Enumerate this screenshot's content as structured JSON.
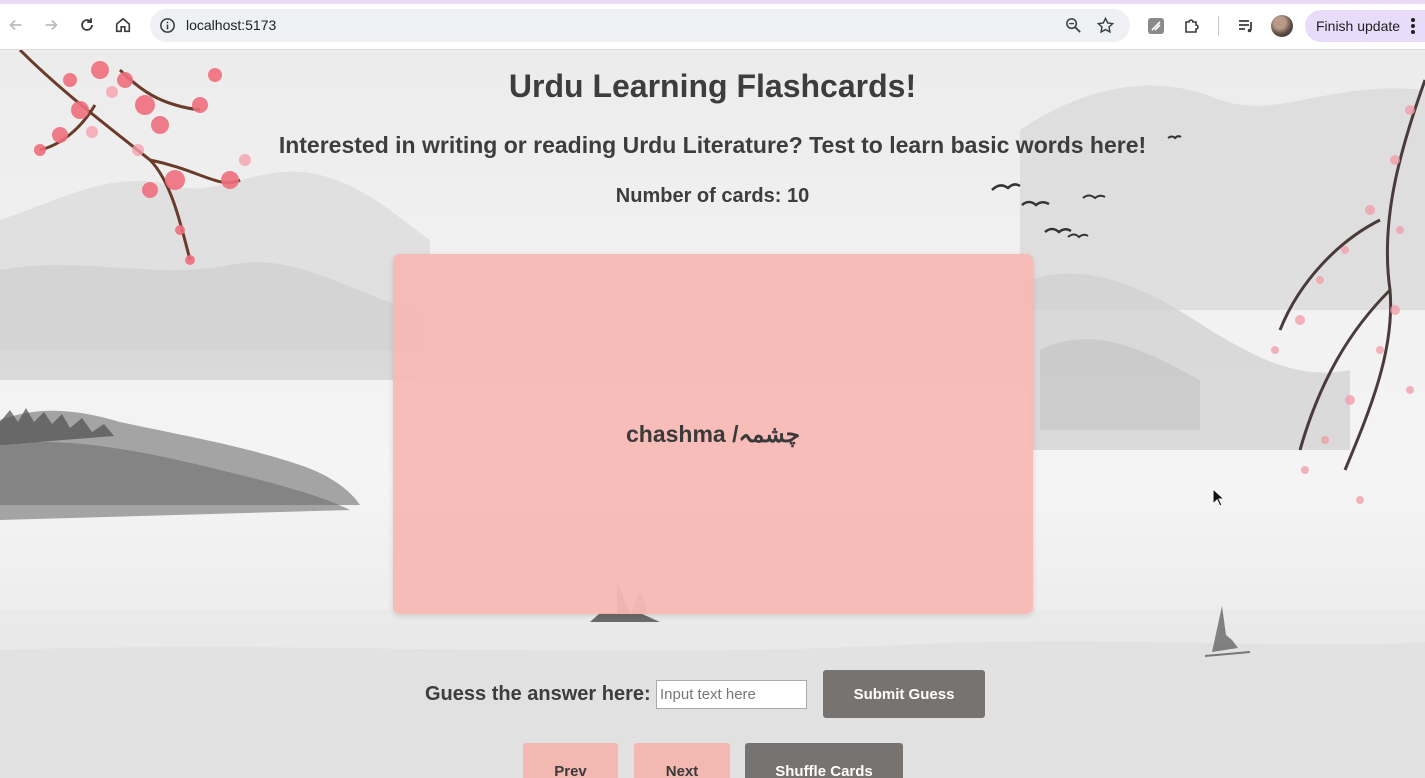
{
  "browser": {
    "url": "localhost:5173",
    "update_label": "Finish update"
  },
  "page": {
    "title": "Urdu Learning Flashcards!",
    "subtitle": "Interested in writing or reading Urdu Literature? Test to learn basic words here!",
    "card_count_label": "Number of cards:",
    "card_count": "10"
  },
  "card": {
    "text": "chashma /چشمہ"
  },
  "guess": {
    "label": "Guess the answer here:",
    "placeholder": "Input text here",
    "value": "",
    "submit_label": "Submit Guess"
  },
  "controls": {
    "prev_label": "Prev",
    "next_label": "Next",
    "shuffle_label": "Shuffle Cards"
  },
  "colors": {
    "card_pink": "#f8b7b4",
    "button_pink": "#f4b8b3",
    "button_gray": "#777370",
    "text_dark": "#3d3d3d"
  }
}
